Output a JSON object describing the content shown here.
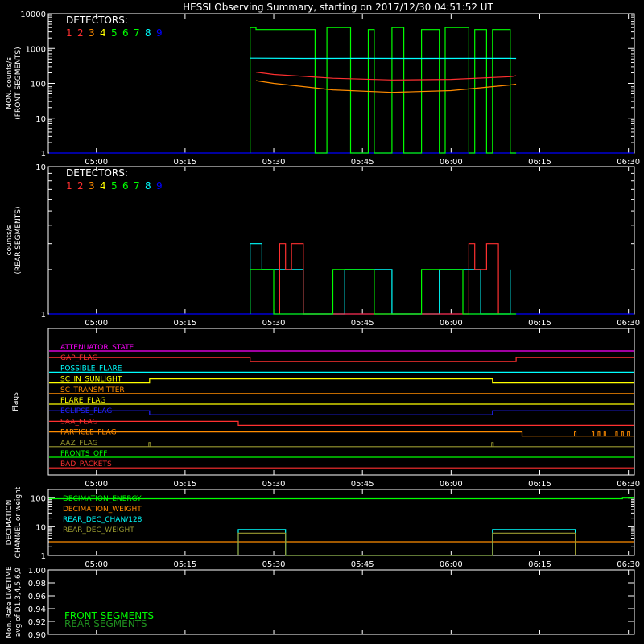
{
  "title": "HESSI Observing Summary, starting on 2017/12/30 04:51:52 UT",
  "colors": {
    "axis": "#ffffff",
    "det": [
      "#ff3030",
      "#ff3030",
      "#ff8c00",
      "#ffff00",
      "#00ff00",
      "#00ff00",
      "#00ff00",
      "#00ffff",
      "#0000ff"
    ],
    "det1": "#ff3030",
    "det3": "#ff8c00",
    "det4": "#ffff00",
    "det6": "#00ff00",
    "det8": "#00ffff",
    "det9": "#2222ff"
  },
  "chart_data": [
    {
      "type": "line",
      "id": "front",
      "ylabel": "MON. counts/s",
      "ylabel2": "(FRONT SEGMENTS)",
      "yscale": "log",
      "ylim": [
        1,
        10000
      ],
      "yticks": [
        1,
        10,
        100,
        1000,
        10000
      ],
      "ytick_labels": [
        "1",
        "10",
        "100",
        "1000",
        "10000"
      ],
      "xlim": [
        "04:51:52",
        "06:31"
      ],
      "xticks": [
        "05:00",
        "05:15",
        "05:30",
        "05:45",
        "06:00",
        "06:15",
        "06:30"
      ],
      "legend_title": "DETECTORS:",
      "legend_numbers": [
        "1",
        "2",
        "3",
        "4",
        "5",
        "6",
        "7",
        "8",
        "9"
      ],
      "legend_position": "top-left",
      "series": [
        {
          "det": 9,
          "x": [
            "04:52",
            "06:31"
          ],
          "y": [
            1,
            1
          ]
        },
        {
          "det": 6,
          "x": [
            "05:26",
            "05:26",
            "05:27",
            "05:27",
            "05:37",
            "05:37",
            "05:39",
            "05:39",
            "05:43",
            "05:43",
            "05:46",
            "05:46",
            "05:47",
            "05:47",
            "05:50",
            "05:50",
            "05:52",
            "05:52",
            "05:55",
            "05:55",
            "05:58",
            "05:58",
            "05:59",
            "05:59",
            "06:03",
            "06:03",
            "06:04",
            "06:04",
            "06:06",
            "06:06",
            "06:07",
            "06:07",
            "06:10",
            "06:10",
            "06:11"
          ],
          "y": [
            1,
            4000,
            4000,
            3500,
            3500,
            1,
            1,
            4000,
            4000,
            1,
            1,
            3500,
            3500,
            1,
            1,
            4000,
            4000,
            1,
            1,
            3500,
            3500,
            1,
            1,
            4000,
            4000,
            1,
            1,
            3500,
            3500,
            1,
            1,
            3500,
            3500,
            1,
            1
          ]
        },
        {
          "det": 8,
          "x": [
            "05:26",
            "05:27",
            "05:35",
            "05:45",
            "05:55",
            "06:05",
            "06:10",
            "06:11"
          ],
          "y": [
            530,
            530,
            520,
            525,
            520,
            525,
            525,
            520
          ]
        },
        {
          "det": 1,
          "x": [
            "05:27",
            "05:30",
            "05:40",
            "05:50",
            "06:00",
            "06:10",
            "06:11"
          ],
          "y": [
            210,
            180,
            140,
            125,
            130,
            155,
            165
          ]
        },
        {
          "det": 3,
          "x": [
            "05:27",
            "05:30",
            "05:40",
            "05:50",
            "06:00",
            "06:10",
            "06:11"
          ],
          "y": [
            120,
            100,
            65,
            55,
            62,
            90,
            95
          ]
        }
      ]
    },
    {
      "type": "line",
      "id": "rear",
      "ylabel": "counts/s",
      "ylabel2": "(REAR SEGMENTS)",
      "yscale": "log",
      "ylim": [
        1,
        10
      ],
      "yticks": [
        1,
        10
      ],
      "ytick_labels": [
        "1",
        "10"
      ],
      "xlim": [
        "04:51:52",
        "06:31"
      ],
      "xticks": [
        "05:00",
        "05:15",
        "05:30",
        "05:45",
        "06:00",
        "06:15",
        "06:30"
      ],
      "legend_title": "DETECTORS:",
      "legend_numbers": [
        "1",
        "2",
        "3",
        "4",
        "5",
        "6",
        "7",
        "8",
        "9"
      ],
      "legend_position": "top-left",
      "series": [
        {
          "det": 9,
          "x": [
            "04:52",
            "06:31"
          ],
          "y": [
            1,
            1
          ]
        },
        {
          "det": 8,
          "x": [
            "05:26",
            "05:26",
            "05:28",
            "05:28",
            "05:35",
            "05:35",
            "05:42",
            "05:42",
            "05:50",
            "05:50",
            "05:58",
            "05:58",
            "06:05",
            "06:05",
            "06:10",
            "06:10"
          ],
          "y": [
            1,
            3,
            3,
            2,
            2,
            1,
            1,
            2,
            2,
            1,
            1,
            2,
            2,
            1,
            1,
            2
          ]
        },
        {
          "det": 1,
          "x": [
            "05:31",
            "05:31",
            "05:32",
            "05:32",
            "05:33",
            "05:33",
            "05:35",
            "05:35",
            "06:03",
            "06:03",
            "06:04",
            "06:04",
            "06:06",
            "06:06",
            "06:08",
            "06:08"
          ],
          "y": [
            1,
            3,
            3,
            2,
            2,
            3,
            3,
            1,
            1,
            3,
            3,
            2,
            2,
            3,
            3,
            1
          ]
        },
        {
          "det": 6,
          "x": [
            "05:26",
            "05:26",
            "05:30",
            "05:30",
            "05:40",
            "05:40",
            "05:47",
            "05:47",
            "05:55",
            "05:55",
            "06:02",
            "06:02",
            "06:11",
            "06:11"
          ],
          "y": [
            1,
            2,
            2,
            1,
            1,
            2,
            2,
            1,
            1,
            2,
            2,
            1,
            1,
            1
          ]
        }
      ]
    },
    {
      "type": "table",
      "id": "flags",
      "ylabel": "Flags",
      "xticks": [
        "05:00",
        "05:15",
        "05:30",
        "05:45",
        "06:00",
        "06:15",
        "06:30"
      ],
      "rows": [
        {
          "name": "ATTENUATOR_STATE",
          "color": "#ff00ff",
          "segments": [
            {
              "from": "04:52",
              "to": "06:31",
              "state": 0
            }
          ]
        },
        {
          "name": "GAP_FLAG",
          "color": "#ff3030",
          "segments": [
            {
              "from": "04:52",
              "to": "05:26",
              "state": 1
            },
            {
              "from": "05:26",
              "to": "06:11",
              "state": 0
            },
            {
              "from": "06:11",
              "to": "06:31",
              "state": 1
            }
          ]
        },
        {
          "name": "POSSIBLE_FLARE",
          "color": "#00ffff",
          "segments": [
            {
              "from": "04:52",
              "to": "06:31",
              "state": 0
            }
          ]
        },
        {
          "name": "SC_IN_SUNLIGHT",
          "color": "#ffff00",
          "segments": [
            {
              "from": "04:52",
              "to": "05:09",
              "state": 0
            },
            {
              "from": "05:09",
              "to": "06:07",
              "state": 1
            },
            {
              "from": "06:07",
              "to": "06:31",
              "state": 0
            }
          ]
        },
        {
          "name": "SC_TRANSMITTER",
          "color": "#ff8c00",
          "segments": [
            {
              "from": "04:52",
              "to": "06:31",
              "state": 0
            }
          ]
        },
        {
          "name": "FLARE_FLAG",
          "color": "#ffff00",
          "segments": [
            {
              "from": "04:52",
              "to": "06:31",
              "state": 0
            }
          ]
        },
        {
          "name": "ECLIPSE_FLAG",
          "color": "#2222ff",
          "segments": [
            {
              "from": "04:52",
              "to": "05:09",
              "state": 1
            },
            {
              "from": "05:09",
              "to": "06:07",
              "state": 0
            },
            {
              "from": "06:07",
              "to": "06:31",
              "state": 1
            }
          ]
        },
        {
          "name": "SAA_FLAG",
          "color": "#ff3030",
          "segments": [
            {
              "from": "04:52",
              "to": "05:24",
              "state": 1
            },
            {
              "from": "05:24",
              "to": "06:31",
              "state": 0
            }
          ]
        },
        {
          "name": "PARTICLE_FLAG",
          "color": "#ff8c00",
          "segments": [
            {
              "from": "04:52",
              "to": "06:12",
              "state": 1
            },
            {
              "from": "06:12",
              "to": "06:31",
              "state": 0
            }
          ],
          "spikes": [
            "06:21",
            "06:24",
            "06:25",
            "06:26",
            "06:28",
            "06:29",
            "06:30"
          ]
        },
        {
          "name": "AAZ_FLAG",
          "color": "#9a9a30",
          "segments": [
            {
              "from": "04:52",
              "to": "06:31",
              "state": 0
            }
          ],
          "spikes": [
            "05:09",
            "06:07"
          ]
        },
        {
          "name": "FRONTS_OFF",
          "color": "#00ff00",
          "segments": [
            {
              "from": "04:52",
              "to": "06:31",
              "state": 0
            }
          ]
        },
        {
          "name": "BAD_PACKETS",
          "color": "#ff3030",
          "segments": [
            {
              "from": "04:52",
              "to": "06:31",
              "state": 0
            }
          ]
        }
      ]
    },
    {
      "type": "line",
      "id": "decimation",
      "ylabel": "DECIMATION",
      "ylabel2": "CHANNEL or weight",
      "yscale": "log",
      "ylim": [
        1,
        200
      ],
      "yticks": [
        1,
        10,
        100
      ],
      "ytick_labels": [
        "1",
        "10",
        "100"
      ],
      "xticks": [
        "05:00",
        "05:15",
        "05:30",
        "05:45",
        "06:00",
        "06:15",
        "06:30"
      ],
      "legend": [
        {
          "name": "DECIMATION_ENERGY",
          "color": "#00ff00"
        },
        {
          "name": "DECIMATION_WEIGHT",
          "color": "#ff8c00"
        },
        {
          "name": "REAR_DEC_CHAN/128",
          "color": "#00ffff"
        },
        {
          "name": "REAR_DEC_WEIGHT",
          "color": "#9a9a30"
        }
      ],
      "series": [
        {
          "name": "DECIMATION_ENERGY",
          "x": [
            "04:52",
            "06:29",
            "06:29",
            "06:31"
          ],
          "y": [
            95,
            95,
            100,
            100
          ]
        },
        {
          "name": "DECIMATION_WEIGHT",
          "x": [
            "04:52",
            "06:31"
          ],
          "y": [
            3,
            3
          ]
        },
        {
          "name": "REAR_DEC_CHAN/128",
          "x": [
            "05:24",
            "05:24",
            "05:32",
            "05:32",
            "06:07",
            "06:07",
            "06:21",
            "06:21"
          ],
          "y": [
            1,
            8,
            8,
            1,
            1,
            8,
            8,
            1
          ]
        },
        {
          "name": "REAR_DEC_WEIGHT",
          "x": [
            "05:24",
            "05:24",
            "05:32",
            "05:32",
            "06:07",
            "06:07",
            "06:21",
            "06:21"
          ],
          "y": [
            1,
            6,
            6,
            1,
            1,
            6,
            6,
            1
          ]
        }
      ]
    },
    {
      "type": "line",
      "id": "livetime",
      "ylabel": "Mon. Rate LIVETIME",
      "ylabel2": "avg of D1,3,4,5,6,9",
      "ylim": [
        0.9,
        1.0
      ],
      "yticks": [
        0.9,
        0.92,
        0.94,
        0.96,
        0.98,
        1.0
      ],
      "ytick_labels": [
        "0.90",
        "0.92",
        "0.94",
        "0.96",
        "0.98",
        "1.00"
      ],
      "legend": [
        {
          "name": "FRONT SEGMENTS",
          "color": "#00ff00"
        },
        {
          "name": "REAR SEGMENTS",
          "color": "#1f8f1f"
        }
      ],
      "series": []
    }
  ]
}
